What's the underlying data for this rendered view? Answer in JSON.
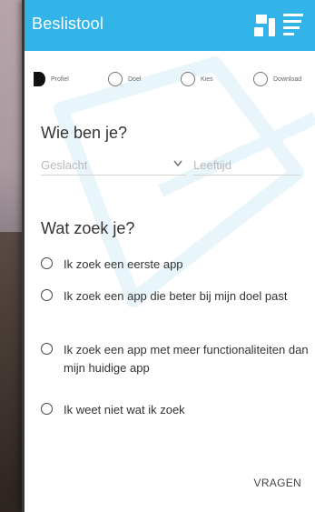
{
  "app": {
    "title": "Beslistool"
  },
  "steps": [
    {
      "label": "Profiel",
      "active": true
    },
    {
      "label": "Doel",
      "active": false
    },
    {
      "label": "Kies",
      "active": false
    },
    {
      "label": "Download",
      "active": false
    }
  ],
  "profile": {
    "heading": "Wie ben je?",
    "gender_placeholder": "Geslacht",
    "age_placeholder": "Leeftijd"
  },
  "search": {
    "heading": "Wat zoek je?",
    "options": [
      "Ik zoek een eerste app",
      "Ik zoek een app die beter bij mijn doel past",
      "Ik zoek een app met meer functionaliteiten dan mijn huidige app",
      "Ik weet niet wat ik zoek"
    ]
  },
  "actions": {
    "submit_label": "VRAGEN"
  },
  "colors": {
    "header": "#33b4e8",
    "text": "#333333"
  }
}
